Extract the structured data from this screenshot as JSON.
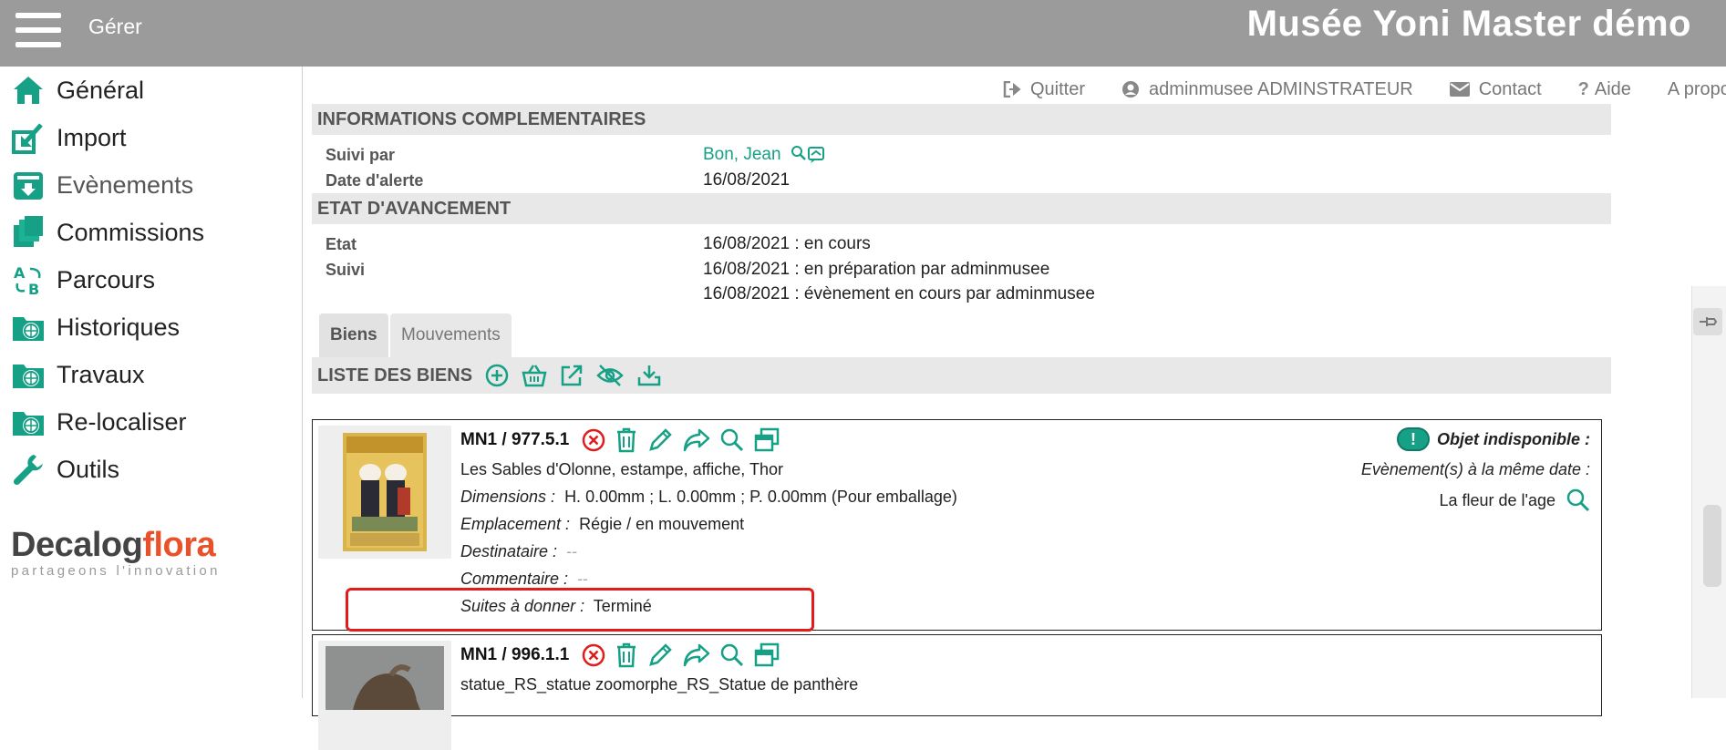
{
  "topbar": {
    "menu_label": "Gérer",
    "app_title": "Musée Yoni Master démo"
  },
  "sidebar": {
    "items": [
      {
        "label": "Général",
        "icon": "home-icon"
      },
      {
        "label": "Import",
        "icon": "import-icon"
      },
      {
        "label": "Evènements",
        "icon": "events-icon"
      },
      {
        "label": "Commissions",
        "icon": "commissions-icon"
      },
      {
        "label": "Parcours",
        "icon": "parcours-icon"
      },
      {
        "label": "Historiques",
        "icon": "history-folder-icon"
      },
      {
        "label": "Travaux",
        "icon": "works-folder-icon"
      },
      {
        "label": "Re-localiser",
        "icon": "relocate-folder-icon"
      },
      {
        "label": "Outils",
        "icon": "wrench-icon"
      }
    ],
    "logo": {
      "part1": "Decalog",
      "part2": "flora",
      "tagline": "partageons l'innovation"
    }
  },
  "header_links": {
    "quit": "Quitter",
    "user": "adminmusee ADMINSTRATEUR",
    "contact": "Contact",
    "help": "Aide",
    "about": "A propos"
  },
  "info": {
    "title": "INFORMATIONS COMPLEMENTAIRES",
    "suivi_par_label": "Suivi par",
    "suivi_par_value": "Bon, Jean",
    "date_alerte_label": "Date d'alerte",
    "date_alerte_value": "16/08/2021"
  },
  "etat": {
    "title": "ETAT D'AVANCEMENT",
    "etat_label": "Etat",
    "etat_value": "16/08/2021 : en cours",
    "suivi_label": "Suivi",
    "suivi_values": [
      "16/08/2021 : en préparation par adminmusee",
      "16/08/2021 : évènement en cours par adminmusee"
    ]
  },
  "tabs": {
    "biens": "Biens",
    "mouvements": "Mouvements"
  },
  "liste": {
    "title": "LISTE DES BIENS",
    "items": [
      {
        "ref": "MN1 / 977.5.1",
        "title": "Les Sables d'Olonne, estampe, affiche, Thor",
        "dimensions_label": "Dimensions :",
        "dimensions_value": "H. 0.00mm ; L. 0.00mm ; P. 0.00mm (Pour emballage)",
        "emplacement_label": "Emplacement :",
        "emplacement_value": "Régie / en mouvement",
        "destinataire_label": "Destinataire :",
        "destinataire_value": "--",
        "commentaire_label": "Commentaire :",
        "commentaire_value": "--",
        "suites_label": "Suites à donner :",
        "suites_value": "Terminé",
        "indispo_label": "Objet indisponible :",
        "indispo_badge": "!",
        "same_date_label": "Evènement(s) à la même date :",
        "same_date_event": "La fleur de l'age"
      },
      {
        "ref": "MN1 / 996.1.1",
        "title": "statue_RS_statue zoomorphe_RS_Statue de panthère"
      }
    ]
  },
  "colors": {
    "accent": "#16a085",
    "danger": "#e21b1b",
    "topbar": "#9b9b9b",
    "logo_orange": "#e8512a"
  }
}
